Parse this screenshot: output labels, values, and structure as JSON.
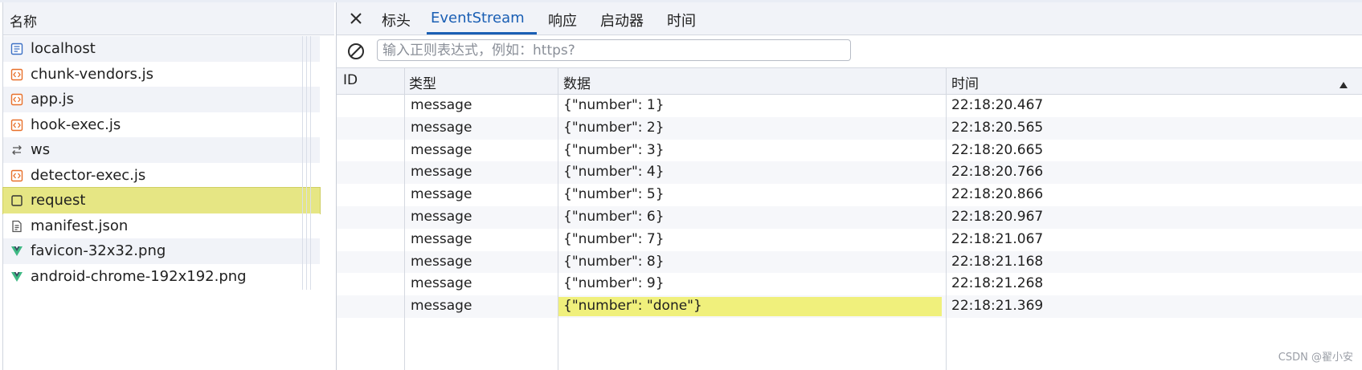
{
  "requests_panel": {
    "header": "名称",
    "items": [
      {
        "label": "localhost",
        "icon": "document-icon"
      },
      {
        "label": "chunk-vendors.js",
        "icon": "script-icon"
      },
      {
        "label": "app.js",
        "icon": "script-icon"
      },
      {
        "label": "hook-exec.js",
        "icon": "script-icon"
      },
      {
        "label": "ws",
        "icon": "websocket-icon"
      },
      {
        "label": "detector-exec.js",
        "icon": "script-icon"
      },
      {
        "label": "request",
        "icon": "blank-icon",
        "selected": true
      },
      {
        "label": "manifest.json",
        "icon": "manifest-icon"
      },
      {
        "label": "favicon-32x32.png",
        "icon": "vue-logo-icon"
      },
      {
        "label": "android-chrome-192x192.png",
        "icon": "vue-logo-icon"
      }
    ]
  },
  "details_panel": {
    "tabs": [
      {
        "label": "标头"
      },
      {
        "label": "EventStream"
      },
      {
        "label": "响应"
      },
      {
        "label": "启动器"
      },
      {
        "label": "时间"
      }
    ],
    "active_tab": "EventStream",
    "filter": {
      "placeholder": "输入正则表达式，例如：https?",
      "value": ""
    },
    "columns": {
      "id": "ID",
      "type": "类型",
      "data": "数据",
      "time": "时间"
    },
    "sort": {
      "column": "时间",
      "direction": "ascending"
    },
    "events": [
      {
        "id": "",
        "type": "message",
        "data": "{\"number\": 1}",
        "time": "22:18:20.467"
      },
      {
        "id": "",
        "type": "message",
        "data": "{\"number\": 2}",
        "time": "22:18:20.565"
      },
      {
        "id": "",
        "type": "message",
        "data": "{\"number\": 3}",
        "time": "22:18:20.665"
      },
      {
        "id": "",
        "type": "message",
        "data": "{\"number\": 4}",
        "time": "22:18:20.766"
      },
      {
        "id": "",
        "type": "message",
        "data": "{\"number\": 5}",
        "time": "22:18:20.866"
      },
      {
        "id": "",
        "type": "message",
        "data": "{\"number\": 6}",
        "time": "22:18:20.967"
      },
      {
        "id": "",
        "type": "message",
        "data": "{\"number\": 7}",
        "time": "22:18:21.067"
      },
      {
        "id": "",
        "type": "message",
        "data": "{\"number\": 8}",
        "time": "22:18:21.168"
      },
      {
        "id": "",
        "type": "message",
        "data": "{\"number\": 9}",
        "time": "22:18:21.268"
      },
      {
        "id": "",
        "type": "message",
        "data": "{\"number\": \"done\"}",
        "time": "22:18:21.369",
        "highlight": true
      }
    ]
  },
  "watermark": "CSDN @翟小安",
  "colors": {
    "accent": "#1a5fb4",
    "selected_row": "#e6e684",
    "highlight": "#f0f07c",
    "script_icon": "#e8702a",
    "vue_icon": "#3fb984"
  }
}
